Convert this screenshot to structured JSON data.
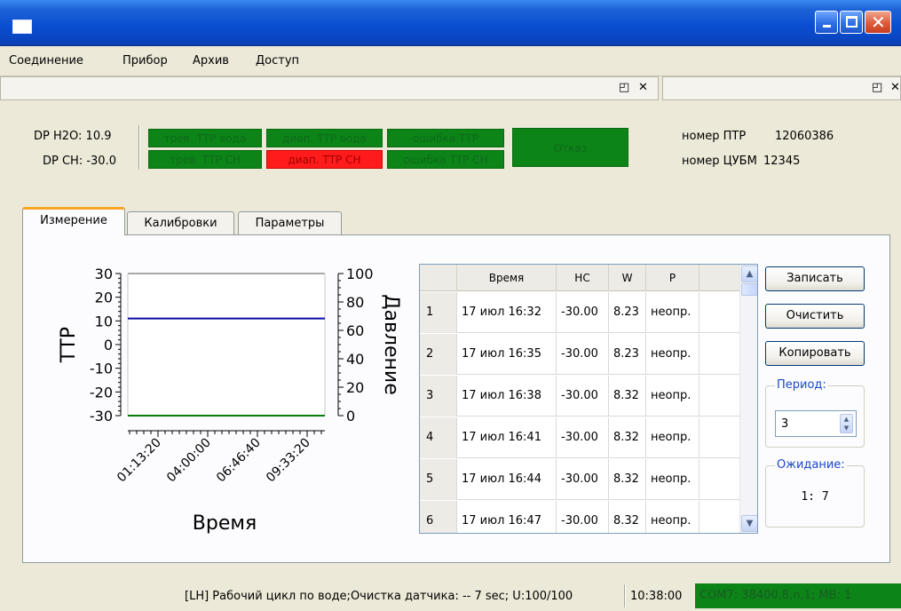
{
  "window": {
    "title": ""
  },
  "menu": [
    "Соединение",
    "Прибор",
    "Архив",
    "Доступ"
  ],
  "dock": {
    "float_icon": "restore-icon",
    "close_icon": "close-icon"
  },
  "status": {
    "dp_h2o": "DP H2O:  10.9",
    "dp_ch": "DP CH:  -30.0",
    "indicators": {
      "trev_water": "трев. ТТР вода",
      "range_water": "диап. ТТР вода",
      "error_ttr": "ошибка ТТР",
      "trev_ch": "трев. ТТР СН",
      "range_ch": "диап. ТТР СН",
      "error_ttr_ch": "ошибка ТТР СН",
      "fail": "Отказ"
    },
    "colors": {
      "ok": "#0c8418",
      "alarm": "#ff1b1b"
    },
    "ptr_label": "номер ПТР",
    "ptr_value": "12060386",
    "cubm_label": "номер ЦУБМ",
    "cubm_value": "12345"
  },
  "tabs": [
    "Измерение",
    "Калибровки",
    "Параметры"
  ],
  "active_tab": "Измерение",
  "chart_data": {
    "type": "line",
    "xlabel": "Время",
    "ylabel_left": "ТТР",
    "ylabel_right": "Давление",
    "ylim_left": [
      -30,
      30
    ],
    "ylim_right": [
      0,
      100
    ],
    "yticks_left": [
      "30",
      "20",
      "10",
      "0",
      "-10",
      "-20",
      "-30"
    ],
    "yticks_right": [
      "100",
      "80",
      "60",
      "40",
      "20",
      "0"
    ],
    "xticks": [
      "01:13:20",
      "04:00:00",
      "06:46:40",
      "09:33:20"
    ],
    "series": [
      {
        "color": "#0a0aa8",
        "y": 11
      },
      {
        "color": "#0a7a0a",
        "y": -30
      }
    ],
    "top_line_color": "#a9a9a9"
  },
  "table": {
    "headers": [
      "",
      "Время",
      "НС",
      "W",
      "P"
    ],
    "rows": [
      [
        "1",
        "17 июл 16:32",
        "-30.00",
        "8.23",
        "неопр."
      ],
      [
        "2",
        "17 июл 16:35",
        "-30.00",
        "8.23",
        "неопр."
      ],
      [
        "3",
        "17 июл 16:38",
        "-30.00",
        "8.32",
        "неопр."
      ],
      [
        "4",
        "17 июл 16:41",
        "-30.00",
        "8.32",
        "неопр."
      ],
      [
        "5",
        "17 июл 16:44",
        "-30.00",
        "8.32",
        "неопр."
      ],
      [
        "6",
        "17 июл 16:47",
        "-30.00",
        "8.32",
        "неопр."
      ]
    ]
  },
  "buttons": {
    "record": "Записать",
    "clear": "Очистить",
    "copy": "Копировать"
  },
  "period": {
    "title": "Период:",
    "value": "3"
  },
  "waiting": {
    "title": "Ожидание:",
    "value": "1: 7"
  },
  "statusbar": {
    "message": "[LH] Рабочий цикл по воде;Очистка датчика: --  7 sec; U:100/100",
    "time": "10:38:00",
    "com": "COM7: 38400,8,n,1; MB: 1"
  }
}
